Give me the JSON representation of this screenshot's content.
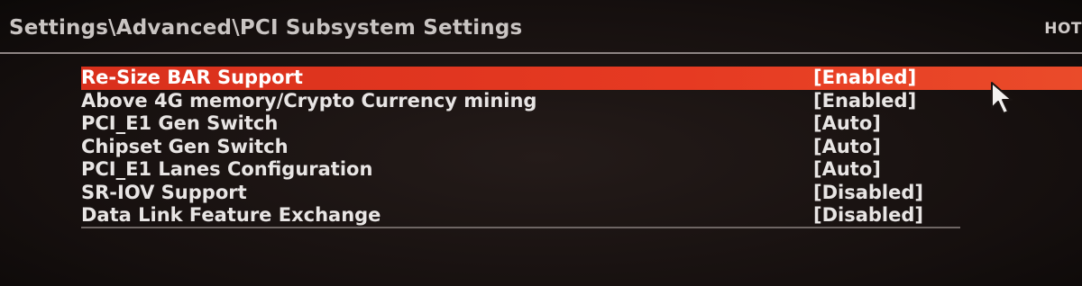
{
  "header": {
    "breadcrumb": "Settings\\Advanced\\PCI Subsystem Settings",
    "hotkey_label": "HOT"
  },
  "menu": {
    "items": [
      {
        "label": "Re-Size BAR Support",
        "value": "[Enabled]",
        "selected": true
      },
      {
        "label": "Above 4G memory/Crypto Currency mining",
        "value": "[Enabled]",
        "selected": false
      },
      {
        "label": "PCI_E1 Gen Switch",
        "value": "[Auto]",
        "selected": false
      },
      {
        "label": "Chipset Gen Switch",
        "value": "[Auto]",
        "selected": false
      },
      {
        "label": "PCI_E1 Lanes Configuration",
        "value": "[Auto]",
        "selected": false
      },
      {
        "label": "SR-IOV Support",
        "value": "[Disabled]",
        "selected": false
      },
      {
        "label": "Data Link Feature Exchange",
        "value": "[Disabled]",
        "selected": false
      }
    ]
  },
  "colors": {
    "highlight": "#e2361f",
    "text": "#e8e5e4",
    "background": "#171210"
  },
  "icons": {
    "pointer": "mouse-cursor-icon"
  }
}
